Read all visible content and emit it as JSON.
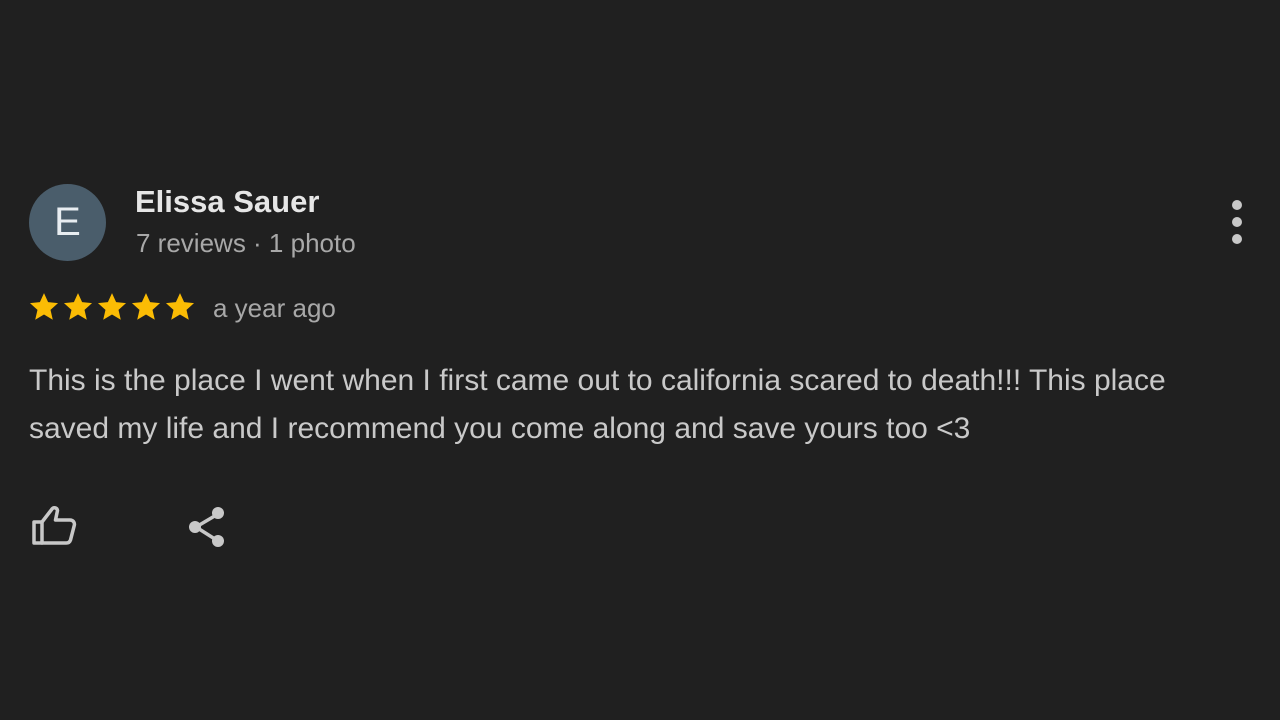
{
  "review": {
    "author": {
      "initial": "E",
      "name": "Elissa Sauer",
      "meta": "7 reviews · 1 photo",
      "avatar_color": "#4a5d6b"
    },
    "rating": {
      "stars": 5,
      "max_stars": 5,
      "star_color": "#fbbc04"
    },
    "date": "a year ago",
    "text": "This is the place I went when I first came out to california scared to death!!! This place saved my life and I recommend you come along and save yours too <3",
    "actions": {
      "like_icon": "thumbs-up-icon",
      "share_icon": "share-icon",
      "more_icon": "more-vertical-icon"
    }
  }
}
